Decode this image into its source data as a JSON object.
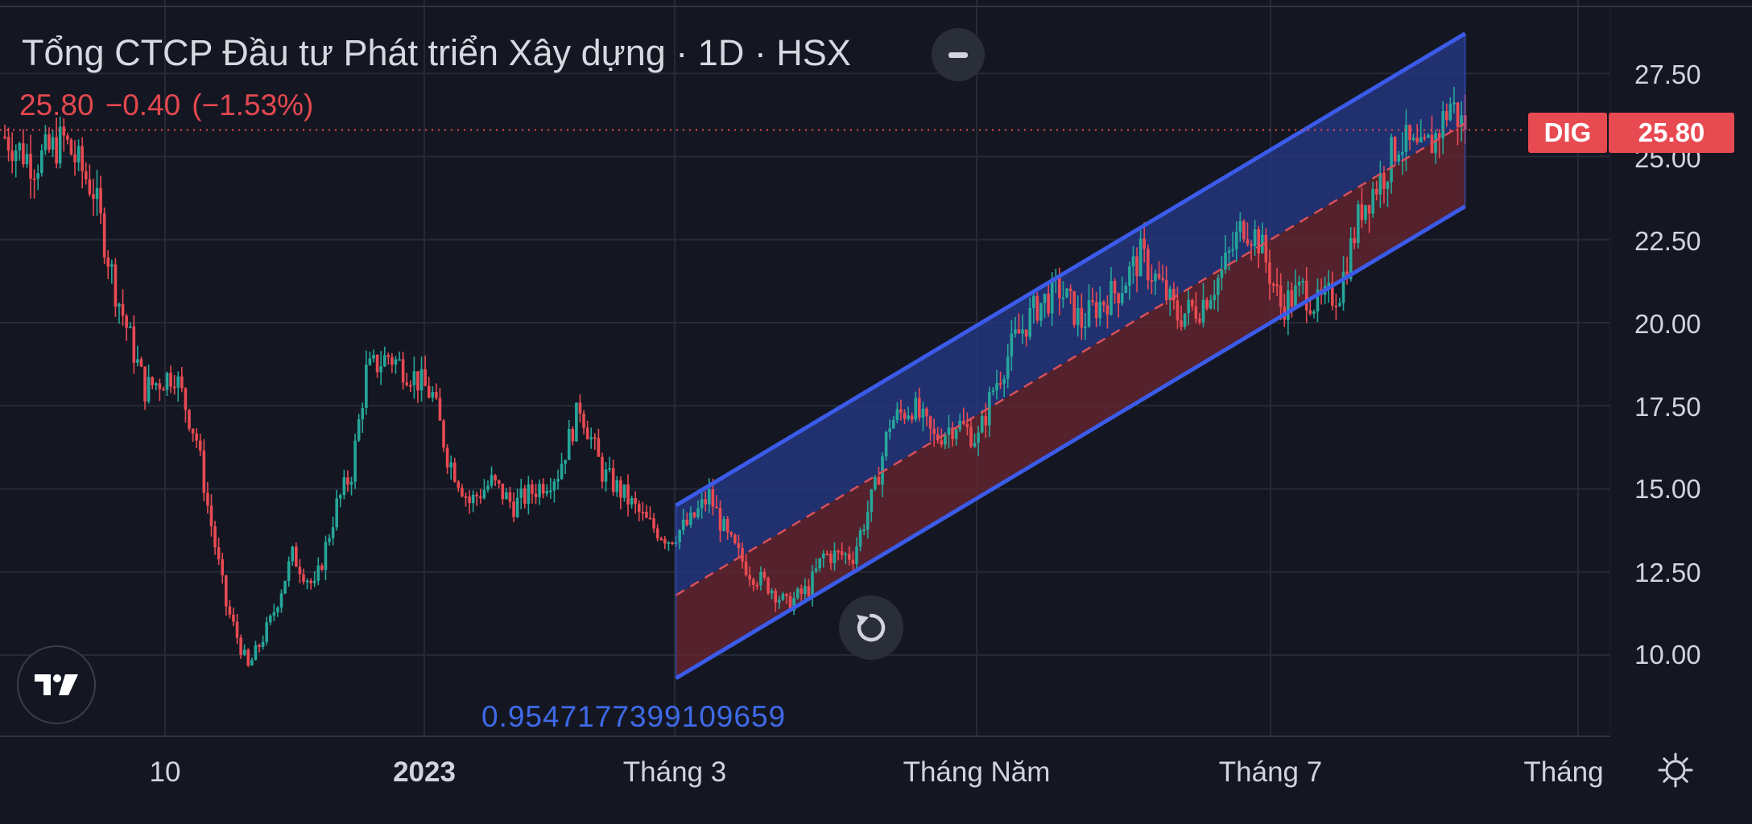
{
  "header": {
    "title": "Tổng CTCP Đầu tư Phát triển Xây dựng · 1D · HSX",
    "last_price": "25.80",
    "change": "−0.40",
    "change_pct": "(−1.53%)"
  },
  "symbol": "DIG",
  "last_price_badge": "25.80",
  "regression_value": "0.9547177399109659",
  "x_axis_labels": [
    "10",
    "2023",
    "Tháng 3",
    "Tháng Năm",
    "Tháng 7",
    "Tháng"
  ],
  "icons": {
    "collapse": "minus-icon",
    "logo": "tradingview-logo-icon",
    "reset": "reset-chart-icon",
    "settings": "gear-icon"
  },
  "colors": {
    "background": "#141722",
    "up": "#26a69a",
    "down": "#e84a52",
    "channel_line": "#3b5be8",
    "channel_upper_fill": "#263a8a",
    "channel_lower_fill": "#6a2630",
    "text": "#d1d4dc"
  },
  "chart_data": {
    "type": "candlestick",
    "title": "Tổng CTCP Đầu tư Phát triển Xây dựng · 1D · HSX",
    "symbol": "DIG",
    "y_ticks": [
      10.0,
      12.5,
      15.0,
      17.5,
      20.0,
      22.5,
      25.0,
      27.5
    ],
    "y_tick_labels": [
      "10.00",
      "12.50",
      "15.00",
      "17.50",
      "20.00",
      "22.50",
      "25.00",
      "27.50"
    ],
    "ylim": [
      7.5,
      29.0
    ],
    "last_value": 25.8,
    "grid": true,
    "series": {
      "name": "DIG",
      "close_path": [
        [
          0,
          25.6
        ],
        [
          8,
          24.8
        ],
        [
          16,
          25.5
        ],
        [
          24,
          24.0
        ],
        [
          30,
          21.0
        ],
        [
          38,
          18.0
        ],
        [
          46,
          18.5
        ],
        [
          52,
          16.5
        ],
        [
          55,
          14.5
        ],
        [
          60,
          11.5
        ],
        [
          66,
          9.6
        ],
        [
          72,
          11.0
        ],
        [
          78,
          13.0
        ],
        [
          84,
          12.0
        ],
        [
          90,
          14.5
        ],
        [
          94,
          15.5
        ],
        [
          98,
          18.5
        ],
        [
          104,
          19.0
        ],
        [
          110,
          18.5
        ],
        [
          116,
          17.8
        ],
        [
          120,
          16.0
        ],
        [
          126,
          14.6
        ],
        [
          132,
          15.2
        ],
        [
          138,
          14.5
        ],
        [
          144,
          15.0
        ],
        [
          150,
          15.5
        ],
        [
          156,
          17.5
        ],
        [
          162,
          15.5
        ],
        [
          168,
          14.8
        ],
        [
          174,
          14.0
        ],
        [
          180,
          13.5
        ],
        [
          186,
          14.0
        ],
        [
          191,
          14.8
        ],
        [
          196,
          13.5
        ],
        [
          202,
          12.5
        ],
        [
          208,
          12.0
        ],
        [
          212,
          11.5
        ],
        [
          218,
          12.0
        ],
        [
          222,
          13.0
        ],
        [
          230,
          13.0
        ],
        [
          236,
          15.0
        ],
        [
          240,
          17.0
        ],
        [
          246,
          17.5
        ],
        [
          252,
          16.5
        ],
        [
          258,
          17.0
        ],
        [
          264,
          16.5
        ],
        [
          268,
          18.0
        ],
        [
          274,
          19.5
        ],
        [
          280,
          20.5
        ],
        [
          286,
          21.0
        ],
        [
          292,
          20.0
        ],
        [
          296,
          20.5
        ],
        [
          302,
          21.0
        ],
        [
          308,
          22.0
        ],
        [
          314,
          21.0
        ],
        [
          318,
          20.2
        ],
        [
          324,
          20.5
        ],
        [
          330,
          21.5
        ],
        [
          336,
          23.0
        ],
        [
          340,
          22.5
        ],
        [
          346,
          20.5
        ],
        [
          352,
          21.0
        ],
        [
          356,
          20.5
        ],
        [
          362,
          21.0
        ],
        [
          368,
          23.5
        ],
        [
          374,
          24.5
        ],
        [
          378,
          25.5
        ],
        [
          384,
          25.0
        ],
        [
          388,
          25.6
        ],
        [
          392,
          26.6
        ],
        [
          396,
          25.8
        ]
      ]
    },
    "regression_channel": {
      "start": {
        "x": 182,
        "upper": 14.5,
        "mid": 11.8,
        "lower": 9.3
      },
      "end": {
        "x": 396,
        "upper": 28.7,
        "mid": 26.0,
        "lower": 23.5
      },
      "value": 0.9547177399109659
    }
  }
}
